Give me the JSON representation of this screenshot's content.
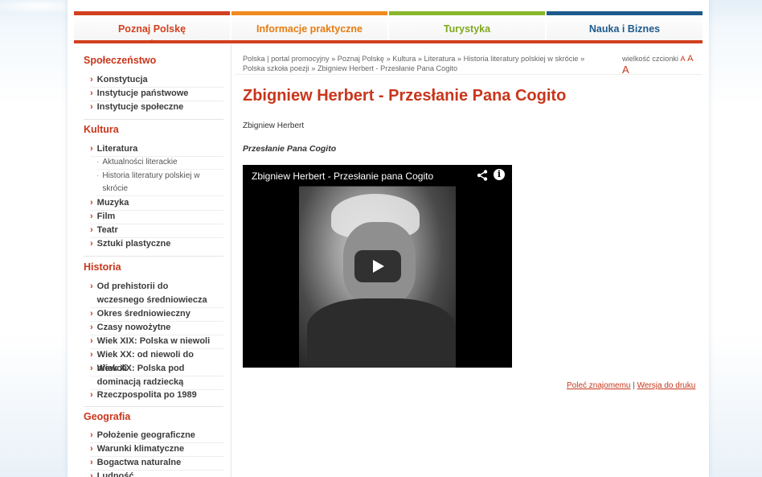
{
  "nav": {
    "tabs": [
      {
        "label": "Poznaj Polskę",
        "color": "#d2401f",
        "active": true
      },
      {
        "label": "Informacje praktyczne",
        "color": "#f08a1d",
        "active": false
      },
      {
        "label": "Turystyka",
        "color": "#8ab72a",
        "active": false
      },
      {
        "label": "Nauka i Biznes",
        "color": "#1e5a8c",
        "active": false
      }
    ]
  },
  "sidebar": {
    "spoleczenstwo": {
      "title": "Społeczeństwo",
      "items": [
        "Konstytucja",
        "Instytucje państwowe",
        "Instytucje społeczne"
      ]
    },
    "kultura": {
      "title": "Kultura",
      "item_literatura": "Literatura",
      "sub": [
        "Aktualności literackie",
        "Historia literatury polskiej w skrócie"
      ],
      "items": [
        "Muzyka",
        "Film",
        "Teatr",
        "Sztuki plastyczne"
      ]
    },
    "historia": {
      "title": "Historia",
      "items": [
        "Od prehistorii do wczesnego średniowiecza",
        "Okres średniowieczny",
        "Czasy nowożytne",
        "Wiek XIX: Polska w niewoli",
        "Wiek XX: od niewoli do niewoli",
        "Wiek XX: Polska pod dominacją radziecką",
        "Rzeczpospolita po 1989"
      ]
    },
    "geografia": {
      "title": "Geografia",
      "items": [
        "Położenie geograficzne",
        "Warunki klimatyczne",
        "Bogactwa naturalne",
        "Ludność"
      ]
    }
  },
  "breadcrumb": "Polska | portal promocyjny » Poznaj Polskę » Kultura » Literatura » Historia literatury polskiej w skrócie » Polska szkoła poezji » Zbigniew Herbert - Przesłanie Pana Cogito",
  "font_size": {
    "label": "wielkość czcionki",
    "a_small": "A",
    "a_medium": "A",
    "a_large": "A"
  },
  "page_title": "Zbigniew Herbert - Przesłanie Pana Cogito",
  "author": "Zbigniew Herbert",
  "poem_title": "Przesłanie Pana Cogito",
  "video": {
    "title": "Zbigniew Herbert - Przesłanie pana Cogito",
    "info_glyph": "i"
  },
  "links": {
    "recommend": "Poleć znajomemu",
    "separator": "|",
    "print": "Wersja do druku"
  },
  "colors": {
    "accent": "#c8361b"
  }
}
